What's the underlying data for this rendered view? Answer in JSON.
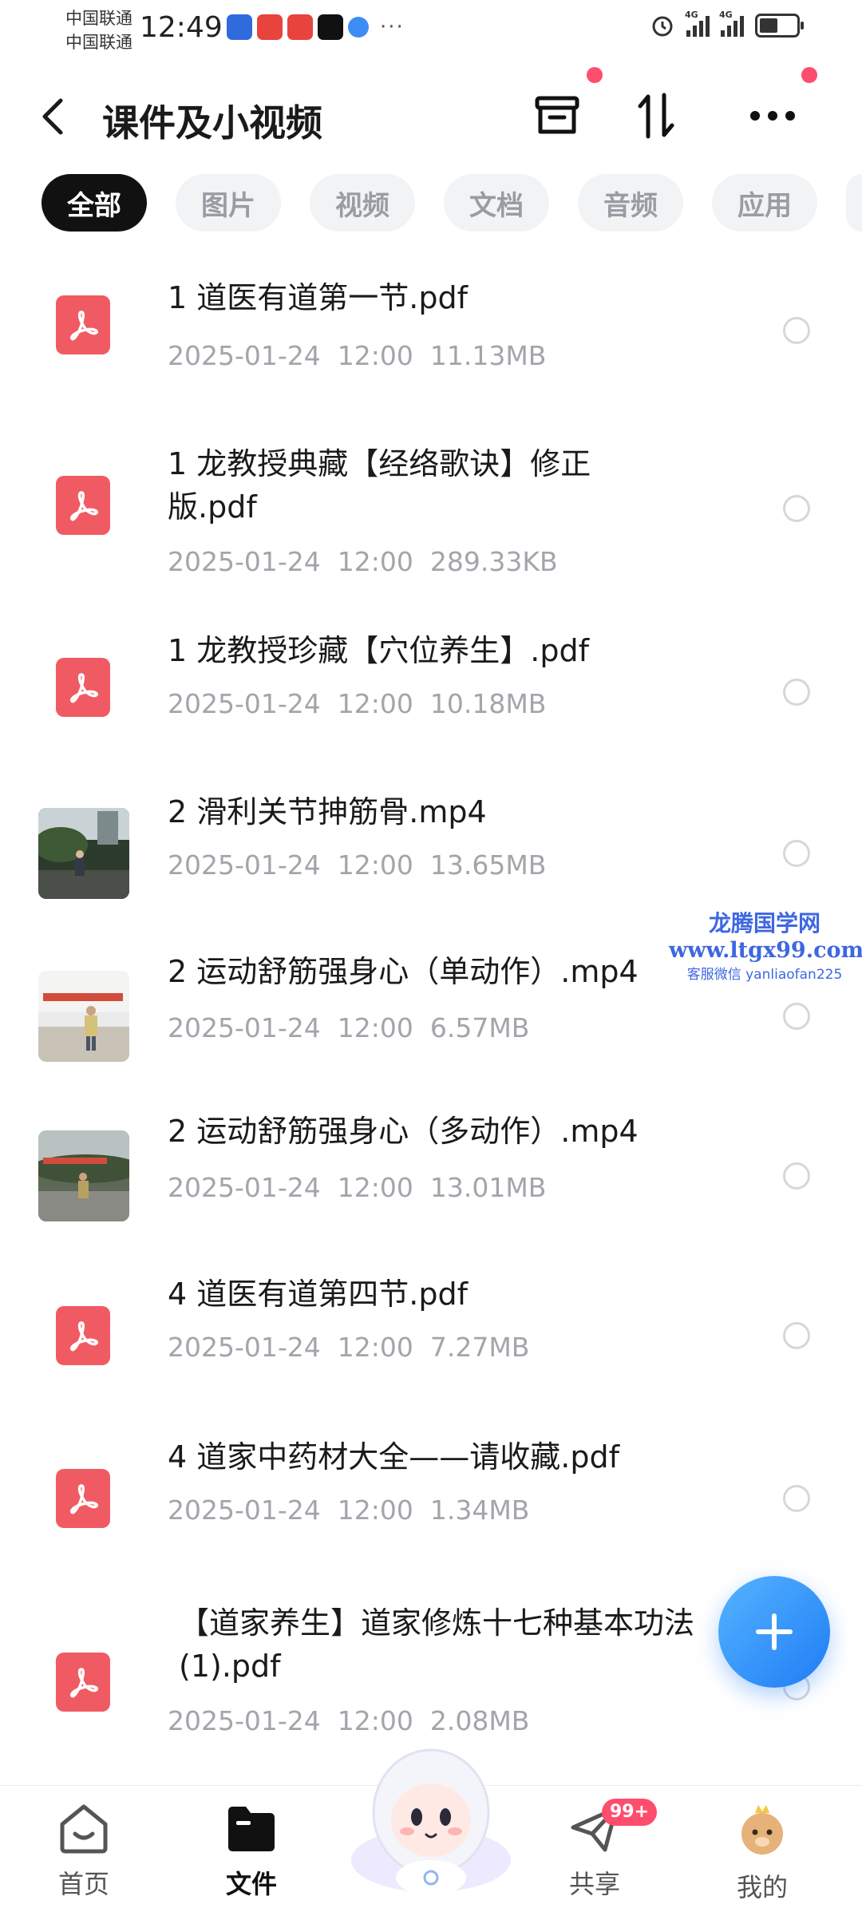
{
  "status_bar": {
    "carrier_1": "中国联通",
    "carrier_2": "中国联通",
    "time": "12:49",
    "more": "···",
    "network_1": "4G",
    "network_2": "4G"
  },
  "header": {
    "title": "课件及小视频"
  },
  "tabs": [
    {
      "label": "全部",
      "active": true
    },
    {
      "label": "图片",
      "active": false
    },
    {
      "label": "视频",
      "active": false
    },
    {
      "label": "文档",
      "active": false
    },
    {
      "label": "音频",
      "active": false
    },
    {
      "label": "应用",
      "active": false
    }
  ],
  "files": [
    {
      "name": "1  道医有道第一节.pdf",
      "date": "2025-01-24",
      "time": "12:00",
      "size": "11.13MB",
      "type": "pdf"
    },
    {
      "name": "1  龙教授典藏【经络歌诀】修正版.pdf",
      "date": "2025-01-24",
      "time": "12:00",
      "size": "289.33KB",
      "type": "pdf"
    },
    {
      "name": "1  龙教授珍藏【穴位养生】.pdf",
      "date": "2025-01-24",
      "time": "12:00",
      "size": "10.18MB",
      "type": "pdf"
    },
    {
      "name": "2  滑利关节抻筋骨.mp4",
      "date": "2025-01-24",
      "time": "12:00",
      "size": "13.65MB",
      "type": "video"
    },
    {
      "name": "2  运动舒筋强身心（单动作）.mp4",
      "date": "2025-01-24",
      "time": "12:00",
      "size": "6.57MB",
      "type": "video"
    },
    {
      "name": "2  运动舒筋强身心（多动作）.mp4",
      "date": "2025-01-24",
      "time": "12:00",
      "size": "13.01MB",
      "type": "video"
    },
    {
      "name": "4  道医有道第四节.pdf",
      "date": "2025-01-24",
      "time": "12:00",
      "size": "7.27MB",
      "type": "pdf"
    },
    {
      "name": "4  道家中药材大全——请收藏.pdf",
      "date": "2025-01-24",
      "time": "12:00",
      "size": "1.34MB",
      "type": "pdf"
    },
    {
      "name": "【道家养生】道家修炼十七种基本功法 (1).pdf",
      "date": "2025-01-24",
      "time": "12:00",
      "size": "2.08MB",
      "type": "pdf"
    }
  ],
  "watermark": {
    "line1": "龙腾国学网",
    "line2": "www.ltgx99.com",
    "line3": "客服微信 yanliaofan225"
  },
  "bottom_nav": {
    "home": "首页",
    "files": "文件",
    "share": "共享",
    "share_badge": "99+",
    "me": "我的"
  },
  "colors": {
    "accent": "#1e7cf6",
    "pdf_red": "#f05b63",
    "badge_red": "#ff4d6d",
    "active_tab": "#111111"
  }
}
